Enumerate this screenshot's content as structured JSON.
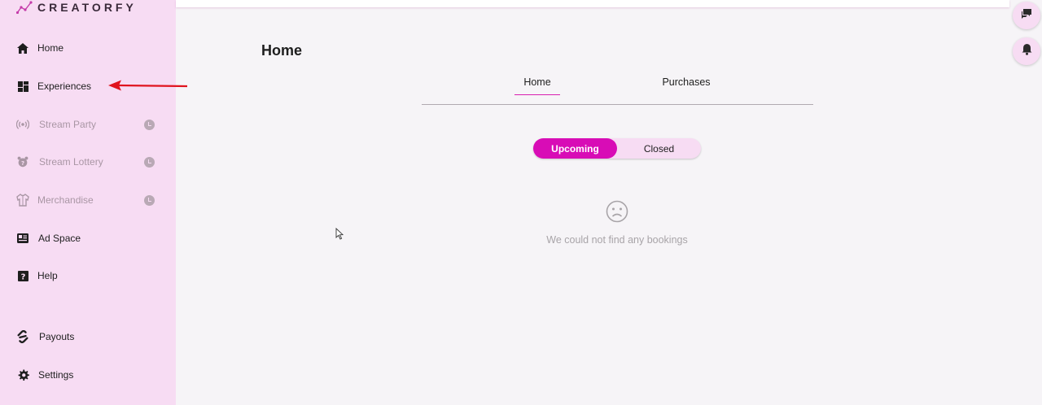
{
  "brand": {
    "name": "CREATORFY"
  },
  "sidebar": {
    "items": [
      {
        "label": "Home",
        "icon": "home-icon",
        "disabled": false
      },
      {
        "label": "Experiences",
        "icon": "dashboard-icon",
        "disabled": false
      },
      {
        "label": "Stream Party",
        "icon": "broadcast-icon",
        "disabled": true
      },
      {
        "label": "Stream Lottery",
        "icon": "lottery-icon",
        "disabled": true
      },
      {
        "label": "Merchandise",
        "icon": "shirt-icon",
        "disabled": true
      },
      {
        "label": "Ad Space",
        "icon": "newspaper-icon",
        "disabled": false
      },
      {
        "label": "Help",
        "icon": "help-icon",
        "disabled": false
      },
      {
        "label": "Payouts",
        "icon": "payouts-icon",
        "disabled": false
      },
      {
        "label": "Settings",
        "icon": "gear-icon",
        "disabled": false
      }
    ]
  },
  "main": {
    "title": "Home",
    "tabs": [
      {
        "label": "Home",
        "active": true
      },
      {
        "label": "Purchases",
        "active": false
      }
    ],
    "segment": {
      "options": [
        {
          "label": "Upcoming",
          "active": true
        },
        {
          "label": "Closed",
          "active": false
        }
      ]
    },
    "empty_state": {
      "icon": "sad-face-icon",
      "message": "We could not find any bookings"
    }
  },
  "colors": {
    "accent": "#d80cb6",
    "sidebar_bg": "#f7dcf3",
    "page_bg": "#f6f4f7",
    "annotation_arrow": "#e0141e"
  }
}
